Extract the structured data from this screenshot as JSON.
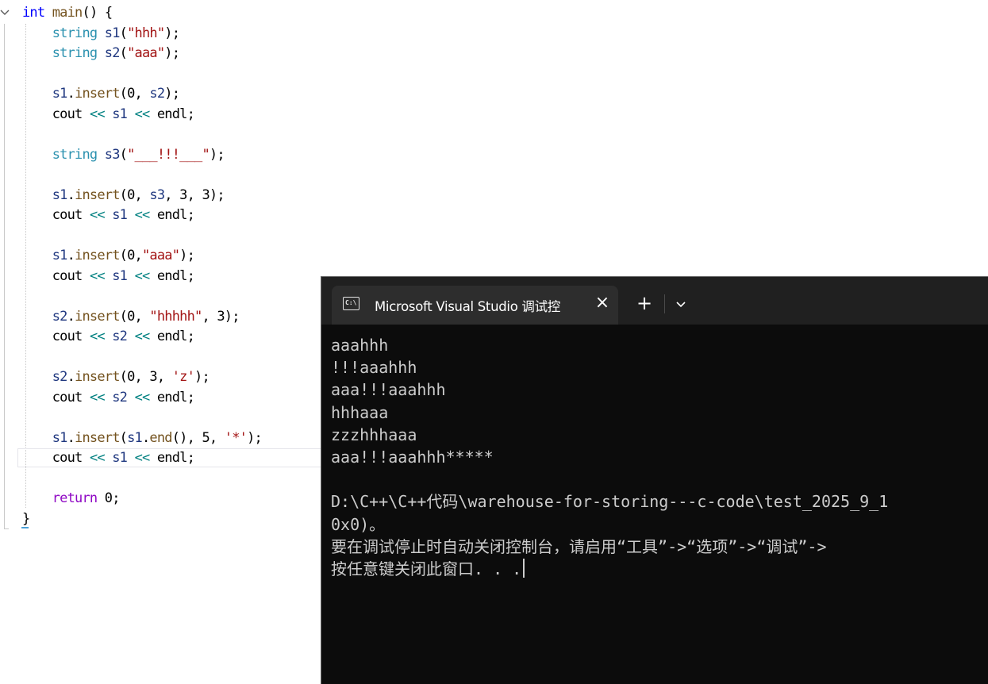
{
  "editor": {
    "lines": [
      "int main() {",
      "    string s1(\"hhh\");",
      "    string s2(\"aaa\");",
      "",
      "    s1.insert(0, s2);",
      "    cout << s1 << endl;",
      "",
      "    string s3(\"___!!!___\");",
      "",
      "    s1.insert(0, s3, 3, 3);",
      "    cout << s1 << endl;",
      "",
      "    s1.insert(0,\"aaa\");",
      "    cout << s1 << endl;",
      "",
      "    s2.insert(0, \"hhhhh\", 3);",
      "    cout << s2 << endl;",
      "",
      "    s2.insert(0, 3, 'z');",
      "    cout << s2 << endl;",
      "",
      "    s1.insert(s1.end(), 5, '*');",
      "    cout << s1 << endl;",
      "",
      "    return 0;",
      "}"
    ]
  },
  "console": {
    "tab_title": "Microsoft Visual Studio 调试控",
    "tab_icon_text": "C:\\",
    "close_symbol": "×",
    "new_tab_symbol": "+",
    "output": [
      "aaahhh",
      "!!!aaahhh",
      "aaa!!!aaahhh",
      "hhhaaa",
      "zzzhhhaaa",
      "aaa!!!aaahhh*****",
      "",
      "D:\\C++\\C++代码\\warehouse-for-storing---c-code\\test_2025_9_1",
      "0x0)。",
      "要在调试停止时自动关闭控制台，请启用“工具”->“选项”->“调试”->",
      "按任意键关闭此窗口. . ."
    ]
  },
  "colors": {
    "keyword": "#0000ff",
    "control_keyword": "#8f08c4",
    "type": "#2b91af",
    "function": "#74531f",
    "string": "#a31515",
    "variable": "#1f377f",
    "operator": "#008080",
    "console_bg": "#0c0c0c",
    "console_text": "#cccccc",
    "titlebar_bg": "#202020",
    "tab_bg": "#2d2d2d"
  },
  "icons": {
    "fold": "chevron-down-icon",
    "tab": "console-app-icon",
    "close": "close-icon",
    "new_tab": "plus-icon",
    "dropdown": "chevron-down-icon"
  }
}
